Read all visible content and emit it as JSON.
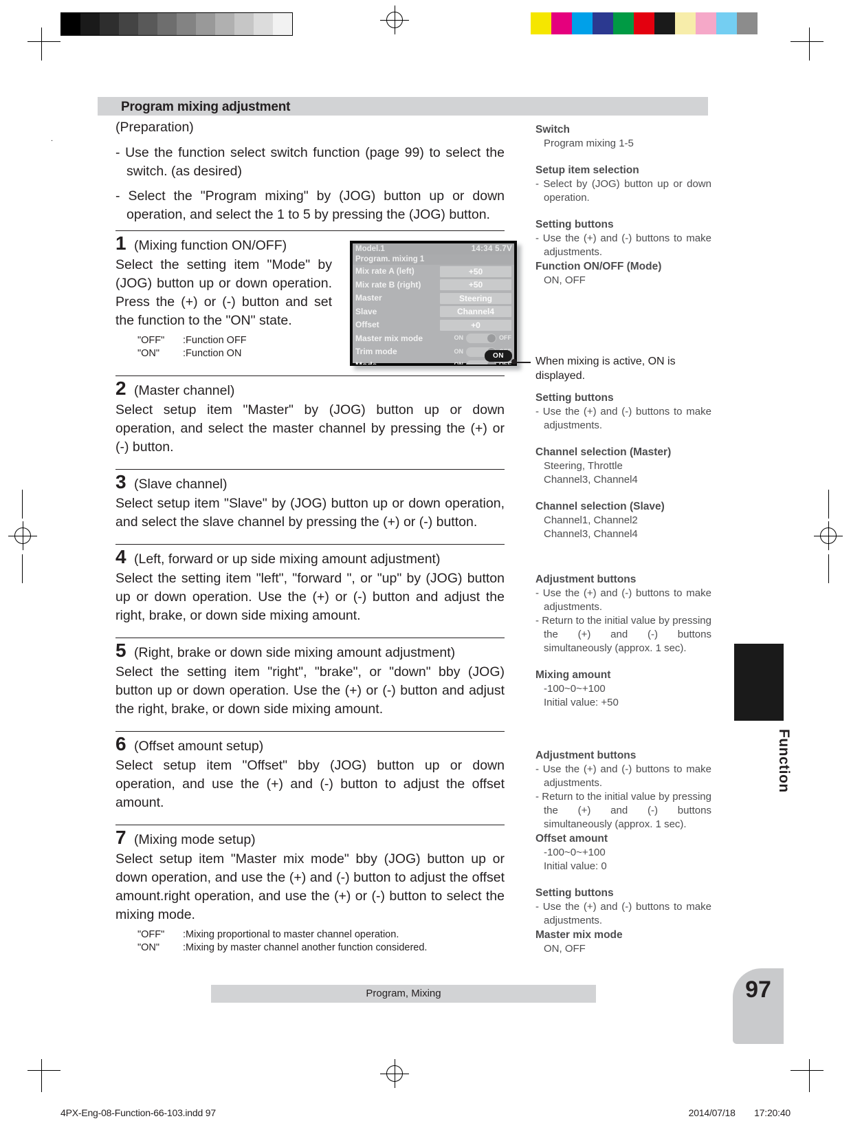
{
  "section": {
    "title": "Program mixing adjustment"
  },
  "preparation": {
    "heading": "(Preparation)",
    "items": [
      "- Use the function select switch function (page 99) to select the switch. (as desired)",
      "- Select the \"Program mixing\" by (JOG) button up or down operation, and select the 1 to 5 by pressing the (JOG) button."
    ]
  },
  "steps": [
    {
      "num": "1",
      "title": "(Mixing function ON/OFF)",
      "body": "Select the setting item \"Mode\" by (JOG) button up or down operation.  Press the (+) or (-) button and set the function to the \"ON\" state.",
      "legend": [
        {
          "key": "\"OFF\"",
          "val": ":Function OFF"
        },
        {
          "key": "\"ON\"",
          "val": ":Function ON"
        }
      ]
    },
    {
      "num": "2",
      "title": "(Master channel)",
      "body": "Select setup item \"Master\" by (JOG) button up or down operation, and select the master channel by pressing the (+) or (-) button."
    },
    {
      "num": "3",
      "title": "(Slave channel)",
      "body": "Select setup item \"Slave\" by (JOG) button up or down operation, and select the slave channel by pressing the (+) or (-) button."
    },
    {
      "num": "4",
      "title": "(Left, forward or up side mixing amount adjustment)",
      "body": "Select the setting item \"left\", \"forward \", or \"up\" by (JOG) button up or down operation. Use the (+) or (-) button and adjust the right, brake, or down side mixing amount."
    },
    {
      "num": "5",
      "title": "(Right, brake or down side mixing amount adjustment)",
      "body": "Select the setting item \"right\", \"brake\", or \"down\" bby (JOG) button up or down operation. Use the (+) or (-) button and adjust the right, brake, or down side mixing amount."
    },
    {
      "num": "6",
      "title": "(Offset amount setup)",
      "body": "Select setup item \"Offset\" bby (JOG) button up or down operation, and use the (+) and (-) button to adjust the offset amount."
    },
    {
      "num": "7",
      "title": "(Mixing mode setup)",
      "body": "Select setup item \"Master mix mode\" bby (JOG) button up or down operation, and use the (+) and (-) button to adjust the offset amount.right operation, and use the (+) or (-) button to select the mixing mode.",
      "legend": [
        {
          "key": "\"OFF\"",
          "val": ":Mixing proportional to master channel operation."
        },
        {
          "key": "\"ON\"",
          "val": ":Mixing by master channel another function considered."
        }
      ]
    }
  ],
  "lcd": {
    "model": "Model.1",
    "clock": "14:34 5.7V",
    "screen_title": "Program. mixing 1",
    "rows": [
      {
        "label": "Mix rate A (left)",
        "value": "+50",
        "type": "value"
      },
      {
        "label": "Mix rate B (right)",
        "value": "+50",
        "type": "value"
      },
      {
        "label": "Master",
        "value": "Steering",
        "type": "value"
      },
      {
        "label": "Slave",
        "value": "Channel4",
        "type": "value"
      },
      {
        "label": "Offset",
        "value": "+0",
        "type": "value"
      },
      {
        "label": "Master mix mode",
        "on": "ON",
        "off": "OFF",
        "type": "toggle"
      },
      {
        "label": "Trim mode",
        "on": "ON",
        "off": "OFF",
        "type": "toggle"
      },
      {
        "label": "Mode",
        "on": "ON",
        "off": "OFF",
        "type": "toggle"
      }
    ],
    "status_badge": "ON"
  },
  "callout": {
    "text": "When mixing is active, ON is displayed."
  },
  "right_column": [
    {
      "type": "head",
      "text": "Switch"
    },
    {
      "type": "indent",
      "text": "Program mixing 1-5"
    },
    {
      "type": "spacer"
    },
    {
      "type": "head",
      "text": "Setup item selection"
    },
    {
      "type": "dash",
      "text": "- Select by (JOG) button up or down operation."
    },
    {
      "type": "spacer"
    },
    {
      "type": "head",
      "text": "Setting buttons"
    },
    {
      "type": "dash",
      "text": "- Use the (+) and (-) buttons to make adjustments."
    },
    {
      "type": "head",
      "text": "Function ON/OFF (Mode)"
    },
    {
      "type": "indent",
      "text": "ON, OFF"
    }
  ],
  "right_column_2": [
    {
      "type": "head",
      "text": "Setting buttons"
    },
    {
      "type": "dash",
      "text": "- Use the (+) and (-) buttons to make adjustments."
    },
    {
      "type": "spacer"
    },
    {
      "type": "head",
      "text": "Channel selection (Master)"
    },
    {
      "type": "indent",
      "text": "Steering, Throttle"
    },
    {
      "type": "indent",
      "text": "Channel3, Channel4"
    },
    {
      "type": "spacer"
    },
    {
      "type": "head",
      "text": "Channel selection (Slave)"
    },
    {
      "type": "indent",
      "text": "Channel1, Channel2"
    },
    {
      "type": "indent",
      "text": "Channel3, Channel4"
    }
  ],
  "right_column_3": [
    {
      "type": "head",
      "text": "Adjustment buttons"
    },
    {
      "type": "dash",
      "text": "- Use the (+) and (-) buttons to make adjustments."
    },
    {
      "type": "dash",
      "text": "- Return to the initial value by pressing the (+) and (-) buttons simultaneously (approx. 1 sec)."
    },
    {
      "type": "spacer"
    },
    {
      "type": "head",
      "text": "Mixing amount"
    },
    {
      "type": "indent",
      "text": "-100~0~+100"
    },
    {
      "type": "indent",
      "text": "Initial value: +50"
    }
  ],
  "right_column_4": [
    {
      "type": "head",
      "text": "Adjustment buttons"
    },
    {
      "type": "dash",
      "text": "- Use the (+) and (-) buttons to make adjustments."
    },
    {
      "type": "dash",
      "text": "- Return to the initial value by pressing the (+) and (-) buttons simultaneously (approx. 1 sec)."
    },
    {
      "type": "head",
      "text": "Offset amount"
    },
    {
      "type": "indent",
      "text": "-100~0~+100"
    },
    {
      "type": "indent",
      "text": "Initial value: 0"
    },
    {
      "type": "spacer"
    },
    {
      "type": "head",
      "text": "Setting buttons"
    },
    {
      "type": "dash",
      "text": "- Use the (+) and (-) buttons to make adjustments."
    },
    {
      "type": "head",
      "text": "Master mix mode"
    },
    {
      "type": "indent",
      "text": "ON, OFF"
    }
  ],
  "side": {
    "vertical_label": "Function"
  },
  "footer": {
    "center_label": "Program, Mixing",
    "page_number": "97"
  },
  "print_slug": {
    "left": "4PX-Eng-08-Function-66-103.indd   97",
    "date": "2014/07/18",
    "time": "17:20:40"
  },
  "colors": {
    "bar_gray": "#d2d3d5",
    "text": "#231f20",
    "right_text": "#4c4c4e",
    "lcd_bg": "#b2b3b5",
    "lcd_text": "#f2f2f2",
    "badge_bg": "#1b1b1b"
  },
  "calibration": {
    "gray_steps": [
      "#000000",
      "#1a1a1a",
      "#2e2e2e",
      "#444444",
      "#595959",
      "#6e6e6e",
      "#838383",
      "#999999",
      "#b0b0b0",
      "#c6c6c6",
      "#dcdcdc",
      "#f2f2f2"
    ],
    "color_patches": [
      "#f5e600",
      "#e5007d",
      "#00a0e9",
      "#2b3990",
      "#009a44",
      "#e3000f",
      "#1a1a1a",
      "#f7edaa",
      "#f5a8c8",
      "#74cef2",
      "#8c8c8c"
    ]
  }
}
